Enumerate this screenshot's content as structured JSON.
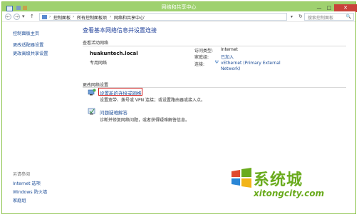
{
  "window": {
    "title": "网络和共享中心",
    "min_label": "—",
    "max_label": "□",
    "close_label": "✕"
  },
  "address_bar": {
    "back": "←",
    "forward": "→",
    "up": "↑",
    "crumbs": [
      "控制面板",
      "所有控制面板项",
      "网络和共享中心"
    ],
    "separator": "›",
    "dropdown": "▾",
    "refresh": "↻",
    "search_placeholder": "搜索控制面板",
    "search_icon": "🔍"
  },
  "sidebar": {
    "links": [
      "控制面板主页",
      "更改适配器设置",
      "更改高级共享设置"
    ],
    "see_also_heading": "另请参阅",
    "see_also": [
      "Internet 选项",
      "Windows 防火墙",
      "家庭组"
    ]
  },
  "main": {
    "heading": "查看基本网络信息并设置连接",
    "active_networks_label": "查看活动网络",
    "network": {
      "name": "huakuntech.local",
      "category": "专用网络",
      "access_type_key": "访问类型:",
      "access_type_val": "Internet",
      "homegroup_key": "家庭组:",
      "homegroup_val": "已加入",
      "connections_key": "连接:",
      "connection_line1": "vEthernet (Primary External",
      "connection_line2": "Network)"
    },
    "change_settings_label": "更改网络设置",
    "items": [
      {
        "link": "设置新的连接或网络",
        "desc": "设置宽带、拨号或 VPN 连接；或设置路由器或接入点。",
        "icon": "new-connection-icon"
      },
      {
        "link": "问题疑难解答",
        "desc": "诊断并修复网络问题，或者获得疑难解答信息。",
        "icon": "troubleshoot-icon"
      }
    ]
  },
  "watermark": {
    "main": "系统城",
    "sub": "xitongcity.com"
  },
  "colors": {
    "accent": "#9fd16f",
    "link": "#1a4b96",
    "heading": "#1e3f9a",
    "highlight_box": "#d11e1e",
    "watermark": "#6aab1d"
  }
}
